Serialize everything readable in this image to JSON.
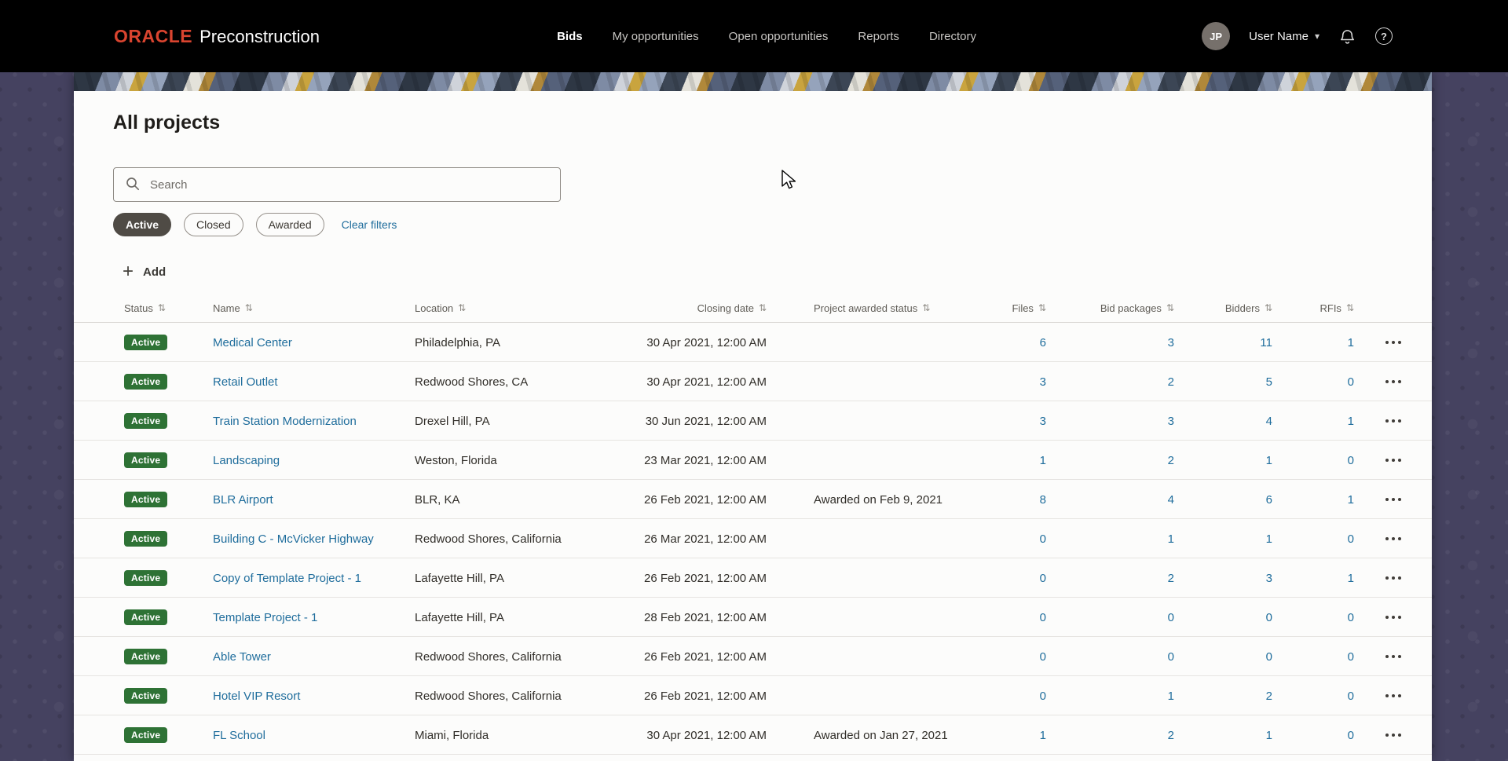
{
  "header": {
    "brand": {
      "oracle": "ORACLE",
      "product": "Preconstruction"
    },
    "nav": [
      {
        "label": "Bids",
        "active": true
      },
      {
        "label": "My opportunities",
        "active": false
      },
      {
        "label": "Open opportunities",
        "active": false
      },
      {
        "label": "Reports",
        "active": false
      },
      {
        "label": "Directory",
        "active": false
      }
    ],
    "user": {
      "initials": "JP",
      "name": "User Name"
    }
  },
  "page": {
    "title": "All projects",
    "search_placeholder": "Search",
    "filters": [
      {
        "label": "Active",
        "selected": true
      },
      {
        "label": "Closed",
        "selected": false
      },
      {
        "label": "Awarded",
        "selected": false
      }
    ],
    "clear_filters_label": "Clear filters",
    "add_label": "Add"
  },
  "table": {
    "columns": [
      "Status",
      "Name",
      "Location",
      "Closing date",
      "Project awarded status",
      "Files",
      "Bid packages",
      "Bidders",
      "RFIs"
    ],
    "rows": [
      {
        "status": "Active",
        "name": "Medical Center",
        "location": "Philadelphia, PA",
        "closing": "30 Apr 2021, 12:00 AM",
        "awarded": "",
        "files": "6",
        "bid_packages": "3",
        "bidders": "11",
        "rfis": "1"
      },
      {
        "status": "Active",
        "name": "Retail Outlet",
        "location": "Redwood Shores, CA",
        "closing": "30 Apr 2021, 12:00 AM",
        "awarded": "",
        "files": "3",
        "bid_packages": "2",
        "bidders": "5",
        "rfis": "0"
      },
      {
        "status": "Active",
        "name": "Train Station Modernization",
        "location": "Drexel Hill, PA",
        "closing": "30 Jun 2021, 12:00 AM",
        "awarded": "",
        "files": "3",
        "bid_packages": "3",
        "bidders": "4",
        "rfis": "1"
      },
      {
        "status": "Active",
        "name": "Landscaping",
        "location": "Weston, Florida",
        "closing": "23 Mar 2021, 12:00 AM",
        "awarded": "",
        "files": "1",
        "bid_packages": "2",
        "bidders": "1",
        "rfis": "0"
      },
      {
        "status": "Active",
        "name": "BLR Airport",
        "location": "BLR, KA",
        "closing": "26 Feb 2021, 12:00 AM",
        "awarded": "Awarded on Feb 9, 2021",
        "files": "8",
        "bid_packages": "4",
        "bidders": "6",
        "rfis": "1"
      },
      {
        "status": "Active",
        "name": "Building C - McVicker Highway",
        "location": "Redwood Shores, California",
        "closing": "26 Mar 2021, 12:00 AM",
        "awarded": "",
        "files": "0",
        "bid_packages": "1",
        "bidders": "1",
        "rfis": "0"
      },
      {
        "status": "Active",
        "name": "Copy of Template Project - 1",
        "location": "Lafayette Hill, PA",
        "closing": "26 Feb 2021, 12:00 AM",
        "awarded": "",
        "files": "0",
        "bid_packages": "2",
        "bidders": "3",
        "rfis": "1"
      },
      {
        "status": "Active",
        "name": "Template Project - 1",
        "location": "Lafayette Hill, PA",
        "closing": "28 Feb 2021, 12:00 AM",
        "awarded": "",
        "files": "0",
        "bid_packages": "0",
        "bidders": "0",
        "rfis": "0"
      },
      {
        "status": "Active",
        "name": "Able Tower",
        "location": "Redwood Shores, California",
        "closing": "26 Feb 2021, 12:00 AM",
        "awarded": "",
        "files": "0",
        "bid_packages": "0",
        "bidders": "0",
        "rfis": "0"
      },
      {
        "status": "Active",
        "name": "Hotel VIP Resort",
        "location": "Redwood Shores, California",
        "closing": "26 Feb 2021, 12:00 AM",
        "awarded": "",
        "files": "0",
        "bid_packages": "1",
        "bidders": "2",
        "rfis": "0"
      },
      {
        "status": "Active",
        "name": "FL School",
        "location": "Miami, Florida",
        "closing": "30 Apr 2021, 12:00 AM",
        "awarded": "Awarded on Jan 27, 2021",
        "files": "1",
        "bid_packages": "2",
        "bidders": "1",
        "rfis": "0"
      }
    ]
  },
  "icons": {
    "sort": "⇅",
    "caret": "▾",
    "plus": "+"
  },
  "colors": {
    "header_bg": "#000000",
    "oracle_red": "#d9442f",
    "page_background": "#454260",
    "card_bg": "#fcfcfb",
    "link_blue": "#1f6d9c",
    "badge_green": "#2e7235",
    "pill_selected": "#4f4b45"
  }
}
